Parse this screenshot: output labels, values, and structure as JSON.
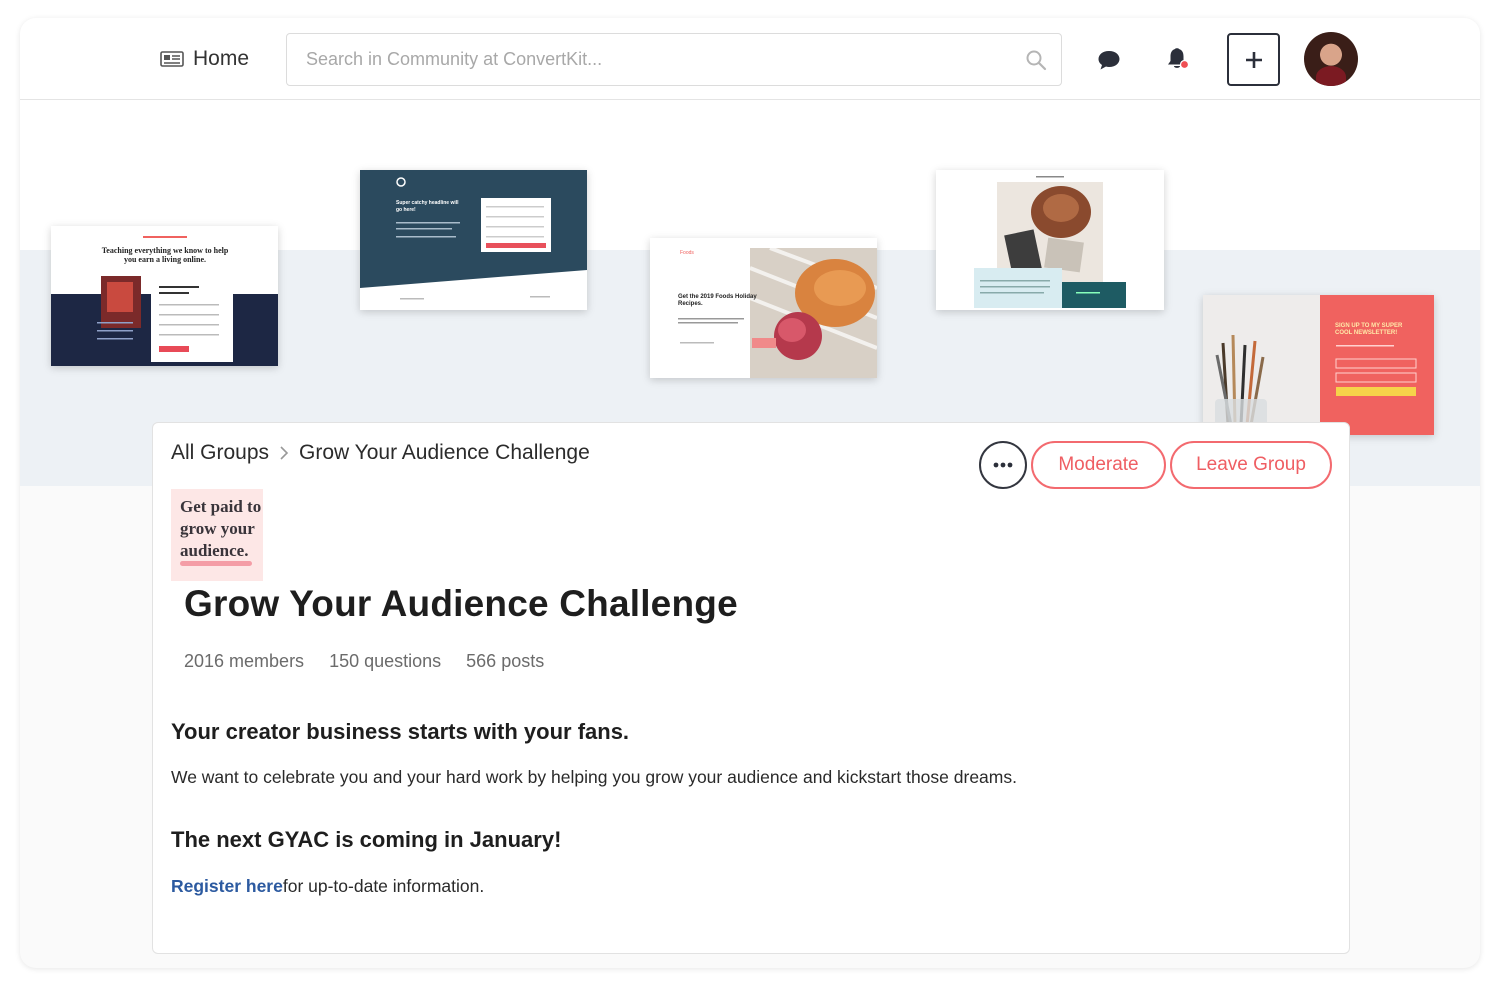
{
  "topbar": {
    "home_label": "Home",
    "search_placeholder": "Search in Community at ConvertKit..."
  },
  "banner": {
    "thumbnails": [
      {
        "heading": "Teaching everything we know to help you earn a living online."
      },
      {
        "heading": "Super catchy headline will go here!"
      },
      {
        "brand": "Foods",
        "heading": "Get the 2019 Foods Holiday Recipes."
      },
      {
        "heading": ""
      },
      {
        "heading": "SIGN UP TO MY SUPER COOL NEWSLETTER!"
      }
    ]
  },
  "group": {
    "breadcrumb_root": "All Groups",
    "breadcrumb_current": "Grow Your Audience Challenge",
    "moderate_label": "Moderate",
    "leave_label": "Leave Group",
    "logo_lines": [
      "Get paid to",
      "grow your",
      "audience."
    ],
    "title": "Grow Your Audience Challenge",
    "members": "2016 members",
    "questions": "150 questions",
    "posts": "566 posts",
    "heading1": "Your creator business starts with your fans.",
    "paragraph1": "We want to celebrate you and your hard work by helping you grow your audience and kickstart those dreams.",
    "heading2": "The next GYAC is coming in January!",
    "register_link": "Register here",
    "paragraph2_rest": "for up-to-date information."
  },
  "colors": {
    "accent": "#ef5e63",
    "link": "#2c5aa0",
    "band": "#edf1f5",
    "navy": "#1d2744",
    "teal": "#2b4a5e",
    "coral": "#f0625f"
  },
  "icons": [
    "newspaper-icon",
    "search-icon",
    "chat-bubble-icon",
    "bell-icon",
    "plus-icon",
    "more-dots-icon",
    "chevron-right-icon"
  ]
}
